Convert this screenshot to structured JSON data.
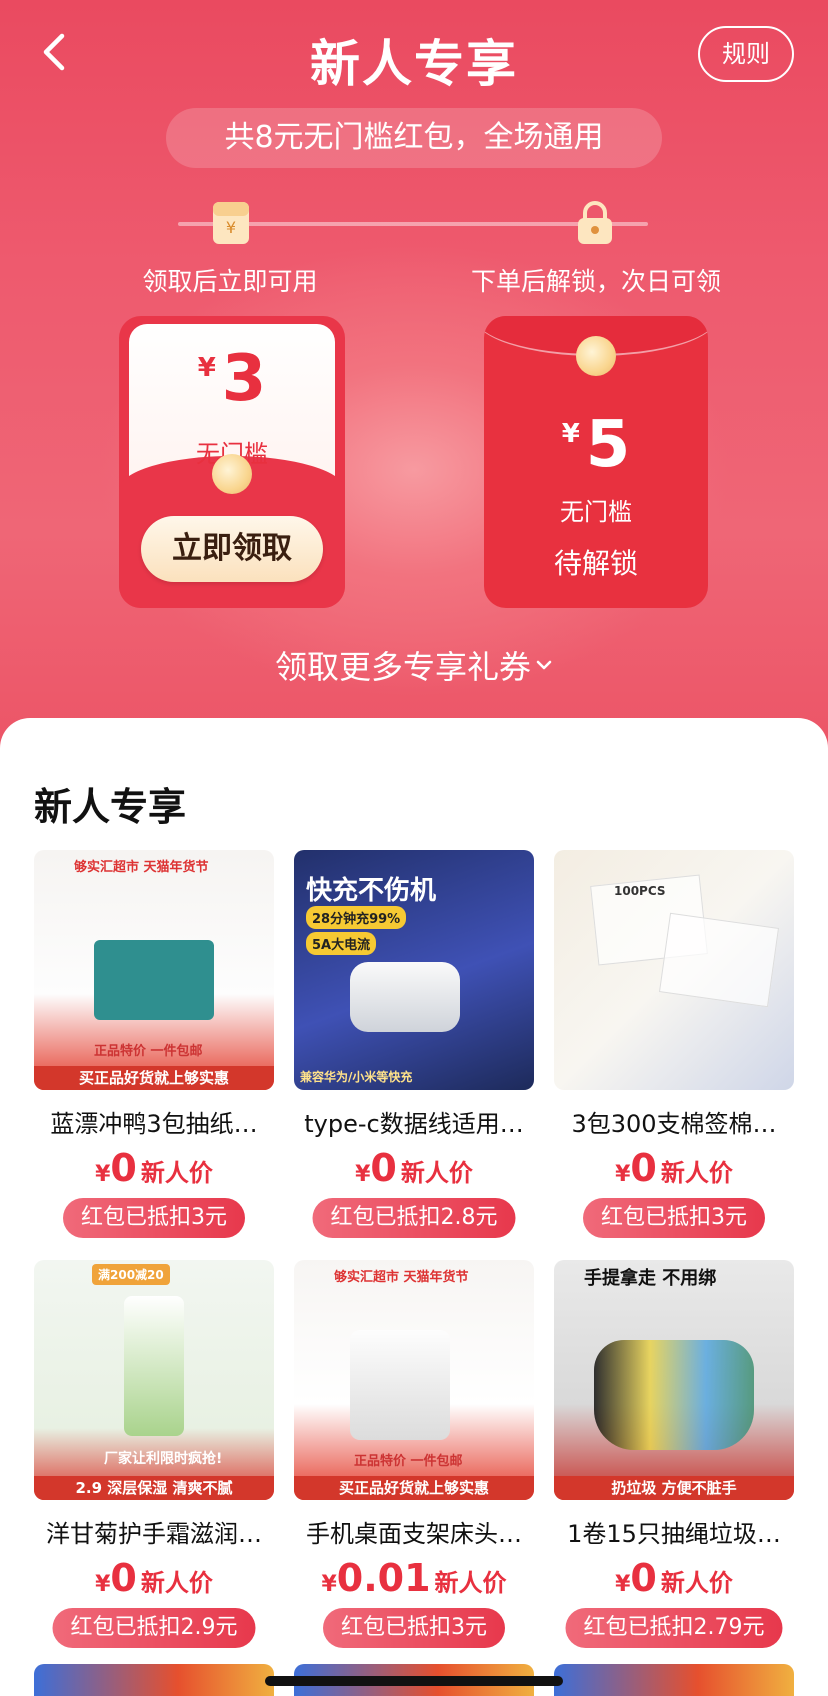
{
  "nav": {
    "title": "新人专享",
    "rule_label": "规则"
  },
  "banner": {
    "subtitle": "共8元无门槛红包，全场通用",
    "step1_label": "领取后立即可用",
    "step2_label": "下单后解锁，次日可领"
  },
  "coupons": [
    {
      "currency": "¥",
      "amount": "3",
      "desc": "无门槛",
      "button": "立即领取"
    },
    {
      "currency": "¥",
      "amount": "5",
      "desc": "无门槛",
      "status": "待解锁"
    }
  ],
  "more_coupons": "领取更多专享礼券",
  "section": {
    "title": "新人专享"
  },
  "products": [
    {
      "name": "蓝漂冲鸭3包抽纸…",
      "currency": "¥",
      "price": "0",
      "price_tag": "新人价",
      "deduct": "红包已抵扣3元",
      "img_text_top": "够实汇超市 天猫年货节",
      "img_text_mid": "正品特价 一件包邮",
      "img_text_bottom": "买正品好货就上够实惠"
    },
    {
      "name": "type-c数据线适用…",
      "currency": "¥",
      "price": "0",
      "price_tag": "新人价",
      "deduct": "红包已抵扣2.8元",
      "img_text_top": "快充不伤机",
      "img_text_mid": "28分钟充99%",
      "img_text_mid2": "5A大电流",
      "img_text_bottom": "兼容华为/小米等快充"
    },
    {
      "name": "3包300支棉签棉…",
      "currency": "¥",
      "price": "0",
      "price_tag": "新人价",
      "deduct": "红包已抵扣3元",
      "img_text_top": "100PCS"
    },
    {
      "name": "洋甘菊护手霜滋润…",
      "currency": "¥",
      "price": "0",
      "price_tag": "新人价",
      "deduct": "红包已抵扣2.9元",
      "img_text_top": "满200减20",
      "img_text_mid": "厂家让利限时疯抢!",
      "img_text_bottom": "2.9 深层保湿 清爽不腻"
    },
    {
      "name": "手机桌面支架床头…",
      "currency": "¥",
      "price": "0.01",
      "price_tag": "新人价",
      "deduct": "红包已抵扣3元",
      "img_text_top": "够实汇超市 天猫年货节",
      "img_text_mid": "正品特价 一件包邮",
      "img_text_bottom": "买正品好货就上够实惠"
    },
    {
      "name": "1卷15只抽绳垃圾…",
      "currency": "¥",
      "price": "0",
      "price_tag": "新人价",
      "deduct": "红包已抵扣2.79元",
      "img_text_top": "手提拿走 不用绑",
      "img_text_bottom": "扔垃圾 方便不脏手"
    }
  ],
  "colors": {
    "primary_red": "#e8303f",
    "hero_bg": "#ea4a60",
    "gold": "#f9d58e"
  }
}
